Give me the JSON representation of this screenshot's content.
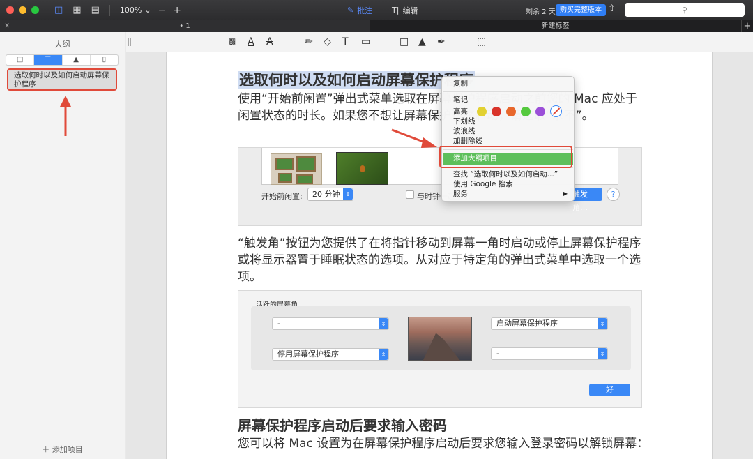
{
  "titlebar": {
    "zoom": "100%",
    "zoom_minus": "−",
    "zoom_plus": "+",
    "mode_annotate": "批注",
    "mode_edit": "编辑",
    "remaining": "剩余 2 天",
    "buy_button": "购买完整版本"
  },
  "tabs": [
    {
      "title": "• 1"
    },
    {
      "title": "新建标签"
    }
  ],
  "sidebar": {
    "title": "大纲",
    "outline_item": "选取何时以及如何启动屏幕保护程序",
    "add_item": "添加项目"
  },
  "document": {
    "title": "选取何时以及如何启动屏幕保护程序",
    "para1": "使用“开始前闲置”弹出式菜单选取在屏幕保护程序启动之前您的 Mac 应处于闲置状态的时长。如果您不想让屏幕保护程序启动，请选取“永不”。",
    "fig1": {
      "idle_label": "开始前闲置:",
      "idle_value": "20 分钟",
      "clock_label": "与时钟一起显示",
      "corner_button": "触发角…",
      "help": "?"
    },
    "para2": "“触发角”按钮为您提供了在将指针移动到屏幕一角时启动或停止屏幕保护程序或将显示器置于睡眠状态的选项。从对应于特定角的弹出式菜单中选取一个选项。",
    "fig2": {
      "caption": "活跃的屏幕角",
      "top_left": "-",
      "top_right": "启动屏幕保护程序",
      "bottom_left": "停用屏幕保护程序",
      "bottom_right": "-",
      "ok": "好"
    },
    "heading2": "屏幕保护程序启动后要求输入密码",
    "para3": "您可以将 Mac 设置为在屏幕保护程序启动后要求您输入登录密码以解锁屏幕："
  },
  "context_menu": {
    "copy": "复制",
    "note": "笔记",
    "highlight": "高亮",
    "underline": "下划线",
    "squiggly": "波浪线",
    "strikethrough": "加删除线",
    "add_outline": "添加大纲项目",
    "find": "查找 “选取何时以及如何启动...”",
    "google": "使用 Google 搜索",
    "services": "服务",
    "colors": [
      "#e2d132",
      "#d9342b",
      "#e8672c",
      "#55c93e",
      "#9b4fd8"
    ]
  },
  "accent_color": "#3a88f6",
  "annotation_color": "#e04a3a"
}
